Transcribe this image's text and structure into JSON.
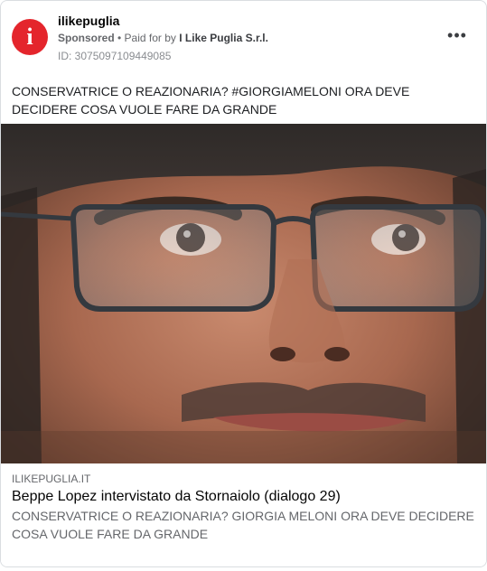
{
  "ad": {
    "page_name": "ilikepuglia",
    "avatar_letter": "i",
    "sponsored": "Sponsored",
    "separator": " • ",
    "paid_for_prefix": "Paid for by ",
    "payer": "I Like Puglia S.r.l.",
    "ad_id": "ID: 3075097109449085",
    "more_label": "•••",
    "body": "CONSERVATRICE O REAZIONARIA? #GIORGIAMELONI ORA DEVE DECIDERE COSA VUOLE FARE DA GRANDE",
    "image_subject": "close-up-face-with-glasses",
    "link": {
      "domain": "ILIKEPUGLIA.IT",
      "title": "Beppe Lopez intervistato da Stornaiolo (dialogo 29)",
      "description": "CONSERVATRICE O REAZIONARIA? GIORGIA MELONI ORA DEVE DECIDERE COSA VUOLE FARE DA GRANDE"
    }
  },
  "colors": {
    "brand_red": "#e4252c",
    "text_secondary": "#65676b",
    "border": "#dadde1"
  }
}
